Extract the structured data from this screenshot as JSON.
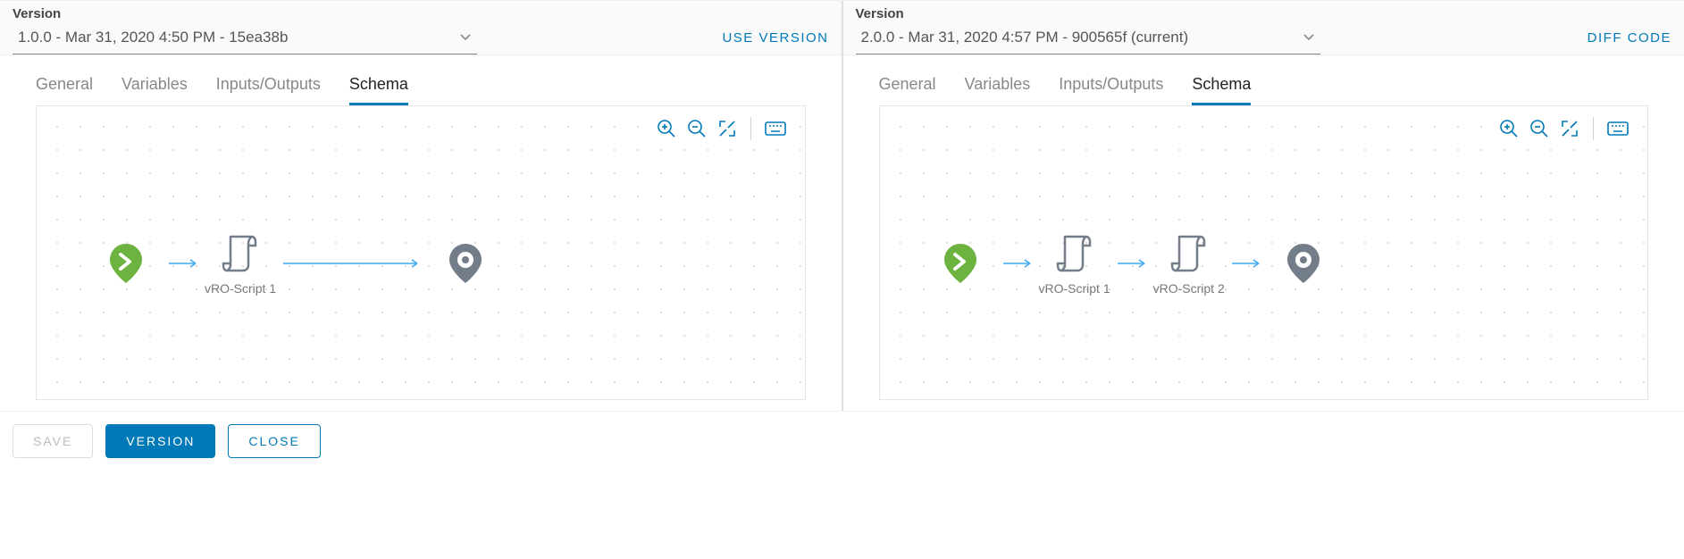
{
  "left": {
    "version_label": "Version",
    "version_value": "1.0.0 - Mar 31, 2020 4:50 PM - 15ea38b",
    "action": "USE VERSION",
    "tabs": [
      "General",
      "Variables",
      "Inputs/Outputs",
      "Schema"
    ],
    "active_tab": "Schema",
    "nodes": [
      {
        "name": "start",
        "label": ""
      },
      {
        "name": "script",
        "label": "vRO-Script 1"
      },
      {
        "name": "end",
        "label": ""
      }
    ]
  },
  "right": {
    "version_label": "Version",
    "version_value": "2.0.0 - Mar 31, 2020 4:57 PM - 900565f (current)",
    "action": "DIFF CODE",
    "tabs": [
      "General",
      "Variables",
      "Inputs/Outputs",
      "Schema"
    ],
    "active_tab": "Schema",
    "nodes": [
      {
        "name": "start",
        "label": ""
      },
      {
        "name": "script",
        "label": "vRO-Script 1"
      },
      {
        "name": "script",
        "label": "vRO-Script 2"
      },
      {
        "name": "end",
        "label": ""
      }
    ]
  },
  "footer": {
    "save": "SAVE",
    "version": "VERSION",
    "close": "CLOSE"
  },
  "colors": {
    "accent": "#0079b8",
    "start": "#6db33f",
    "node": "#737d8a"
  }
}
